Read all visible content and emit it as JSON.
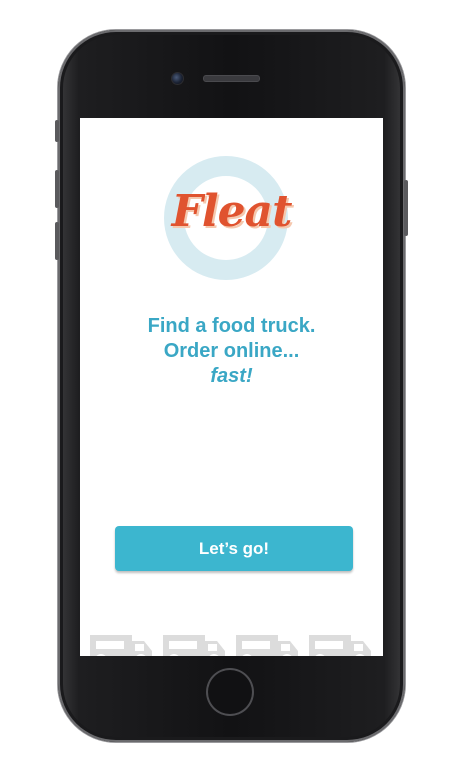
{
  "app": {
    "logo_text": "Fleat"
  },
  "tagline": {
    "line1": "Find a food truck.",
    "line2": "Order online...",
    "line3": "fast!"
  },
  "cta": {
    "label": "Let’s go!"
  },
  "decor": {
    "truck_icons": [
      "food-truck-icon",
      "food-truck-icon",
      "food-truck-icon",
      "food-truck-icon"
    ]
  },
  "colors": {
    "brand_orange": "#e0532f",
    "brand_teal": "#3aa7c5",
    "button_teal": "#3cb6cf",
    "ring_light_blue": "#d7ebf1",
    "truck_gray": "#dcdcdc"
  }
}
